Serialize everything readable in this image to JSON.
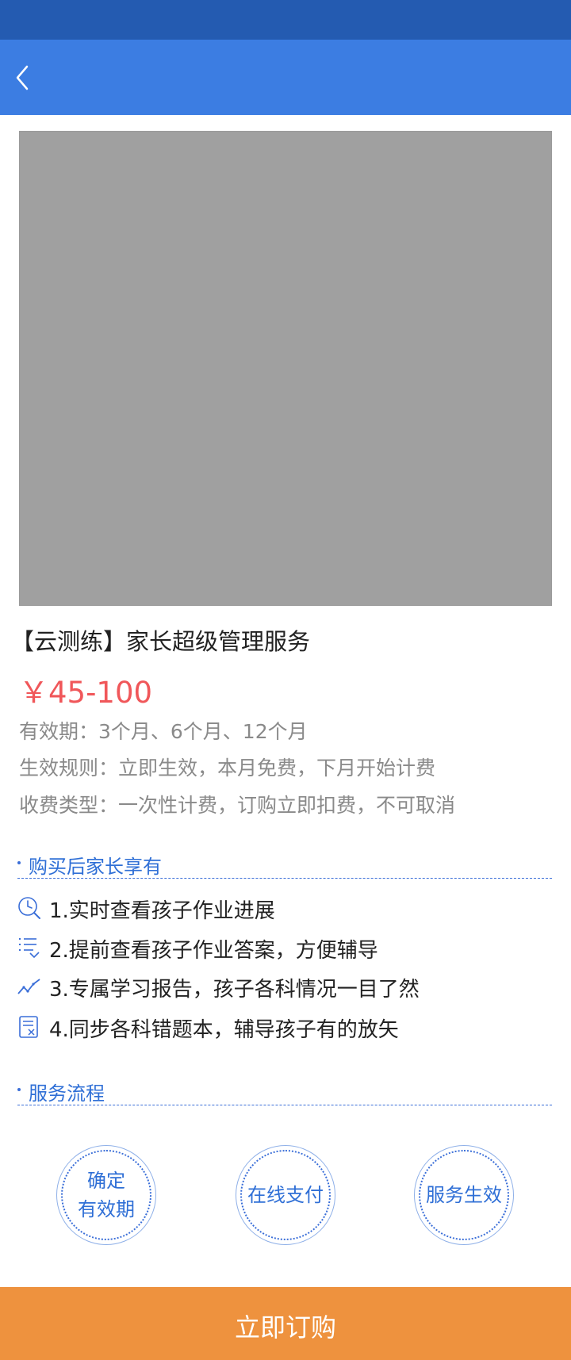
{
  "nav": {
    "back_icon": "chevron-left-icon"
  },
  "product": {
    "image_alt": "product-image-placeholder",
    "title": "【云测练】家长超级管理服务",
    "price": "￥45-100",
    "validity": "有效期：3个月、6个月、12个月",
    "effect_rule": "生效规则：立即生效，本月免费，下月开始计费",
    "fee_type": "收费类型：一次性计费，订购立即扣费，不可取消"
  },
  "benefits": {
    "title": "购买后家长享有",
    "items": [
      {
        "icon": "clock-search-icon",
        "text": "1.实时查看孩子作业进展"
      },
      {
        "icon": "list-icon",
        "text": "2.提前查看孩子作业答案，方便辅导"
      },
      {
        "icon": "trend-chart-icon",
        "text": "3.专属学习报告，孩子各科情况一目了然"
      },
      {
        "icon": "error-document-icon",
        "text": "4.同步各科错题本，辅导孩子有的放矢"
      }
    ]
  },
  "process": {
    "title": "服务流程",
    "steps": [
      {
        "line1": "确定",
        "line2": "有效期"
      },
      {
        "line1": "在线支付",
        "line2": ""
      },
      {
        "line1": "服务生效",
        "line2": ""
      }
    ]
  },
  "buy_button": {
    "label": "立即订购"
  },
  "colors": {
    "nav": "#3c7de2",
    "status_bar": "#245bb1",
    "price": "#f0575a",
    "accent": "#2f6fd6",
    "buy": "#ee923e"
  }
}
